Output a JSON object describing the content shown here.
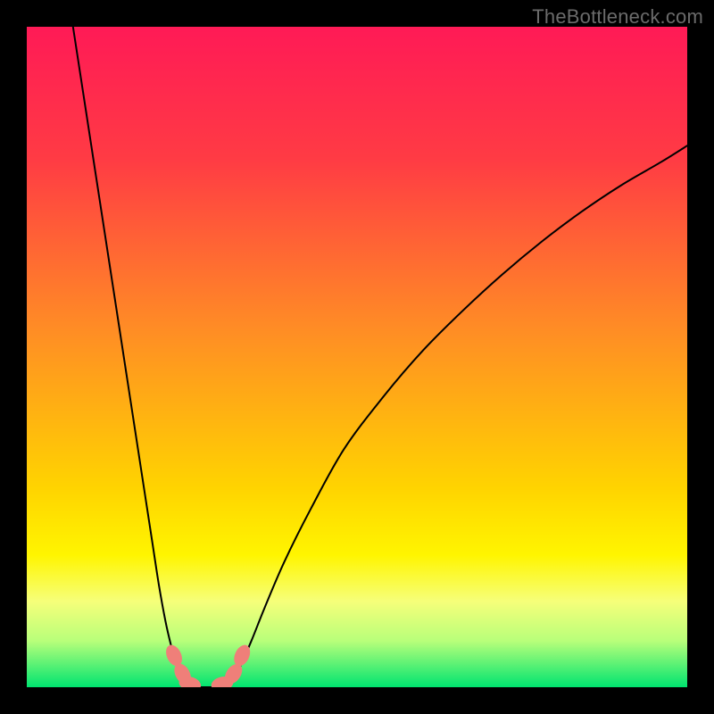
{
  "watermark": "TheBottleneck.com",
  "chart_data": {
    "type": "line",
    "title": "",
    "xlabel": "",
    "ylabel": "",
    "xlim": [
      0,
      100
    ],
    "ylim": [
      0,
      100
    ],
    "background_gradient": {
      "stops": [
        {
          "offset": 0,
          "color": "#ff1a56"
        },
        {
          "offset": 20,
          "color": "#ff3b44"
        },
        {
          "offset": 45,
          "color": "#ff8a26"
        },
        {
          "offset": 70,
          "color": "#ffd400"
        },
        {
          "offset": 80,
          "color": "#fff500"
        },
        {
          "offset": 87,
          "color": "#f6ff7a"
        },
        {
          "offset": 93,
          "color": "#b8ff7a"
        },
        {
          "offset": 100,
          "color": "#00e470"
        }
      ]
    },
    "series": [
      {
        "name": "descending-branch",
        "color": "#000000",
        "width": 2,
        "x": [
          7,
          8,
          9,
          10,
          11,
          12,
          13,
          14,
          15,
          16,
          17,
          18,
          19,
          20,
          21,
          21.8,
          22.5,
          23.1,
          23.7,
          24.3
        ],
        "y": [
          100,
          93.5,
          87,
          80.5,
          74,
          67.5,
          61,
          54.5,
          48,
          41.5,
          35,
          28.5,
          22,
          15.5,
          10,
          6.5,
          4,
          2.3,
          1.1,
          0.3
        ]
      },
      {
        "name": "basin",
        "color": "#000000",
        "width": 2,
        "x": [
          24.3,
          25,
          26,
          27,
          28,
          29,
          30,
          30.8
        ],
        "y": [
          0.3,
          0.05,
          0,
          0,
          0,
          0,
          0.1,
          0.4
        ]
      },
      {
        "name": "ascending-branch",
        "color": "#000000",
        "width": 2,
        "x": [
          30.8,
          32,
          34,
          36,
          39,
          43,
          48,
          54,
          60,
          66,
          72,
          78,
          84,
          90,
          96,
          100
        ],
        "y": [
          0.4,
          2.5,
          7,
          12,
          19,
          27,
          36,
          44,
          51,
          57,
          62.5,
          67.5,
          72,
          76,
          79.5,
          82
        ]
      }
    ],
    "markers": {
      "color": "#ef7f79",
      "radius_px": 10,
      "points": [
        {
          "x": 22.3,
          "y": 4.8
        },
        {
          "x": 23.6,
          "y": 2.0
        },
        {
          "x": 24.7,
          "y": 0.5
        },
        {
          "x": 29.6,
          "y": 0.5
        },
        {
          "x": 31.3,
          "y": 2.0
        },
        {
          "x": 32.6,
          "y": 4.8
        }
      ]
    }
  }
}
